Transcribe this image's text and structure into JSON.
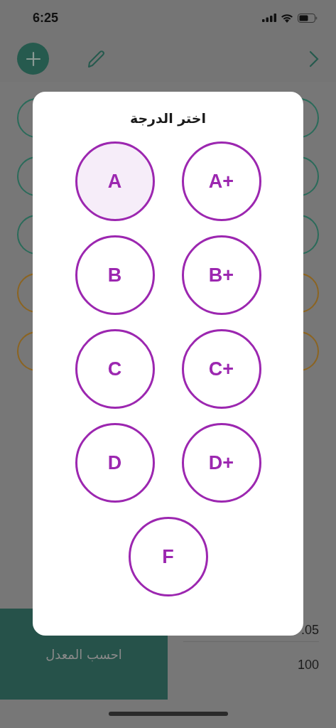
{
  "status_bar": {
    "time": "6:25"
  },
  "rows": [
    {
      "color": "#2a6b5a"
    },
    {
      "color": "#2a6b5a"
    },
    {
      "color": "#2a6b5a"
    },
    {
      "color": "#8c6420"
    },
    {
      "color": "#8c6420"
    }
  ],
  "calculate_button": "احسب المعدل",
  "summary": [
    ".05",
    "100"
  ],
  "dialog": {
    "title": "اختر الدرجة",
    "grades": [
      {
        "label": "A",
        "selected": true
      },
      {
        "label": "A+",
        "selected": false
      },
      {
        "label": "B",
        "selected": false
      },
      {
        "label": "B+",
        "selected": false
      },
      {
        "label": "C",
        "selected": false
      },
      {
        "label": "C+",
        "selected": false
      },
      {
        "label": "D",
        "selected": false
      },
      {
        "label": "D+",
        "selected": false
      },
      {
        "label": "F",
        "selected": false
      }
    ]
  }
}
